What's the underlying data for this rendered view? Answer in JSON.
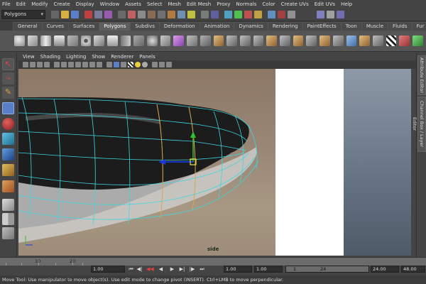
{
  "menubar": {
    "items": [
      "File",
      "Edit",
      "Modify",
      "Create",
      "Display",
      "Window",
      "Assets",
      "Select",
      "Mesh",
      "Edit Mesh",
      "Proxy",
      "Normals",
      "Color",
      "Create UVs",
      "Edit UVs",
      "Help"
    ]
  },
  "statusline": {
    "mode": "Polygons"
  },
  "shelf": {
    "tabs": [
      "General",
      "Curves",
      "Surfaces",
      "Polygons",
      "Subdivs",
      "Deformation",
      "Animation",
      "Dynamics",
      "Rendering",
      "PaintEffects",
      "Toon",
      "Muscle",
      "Fluids",
      "Fur"
    ],
    "active_tab": "Polygons"
  },
  "panel": {
    "menu": [
      "View",
      "Shading",
      "Lighting",
      "Show",
      "Renderer",
      "Panels"
    ],
    "view_label": "side"
  },
  "sidebar": {
    "tabs": [
      "Attribute Editor",
      "Channel Box / Layer Editor"
    ]
  },
  "timeslider": {
    "ticks": [
      "10",
      "20"
    ]
  },
  "range": {
    "current_start": "1.00",
    "anim_start": "1.00",
    "playback_start": "1.00",
    "range_min": "1",
    "range_max": "24",
    "playback_end": "24.00",
    "anim_end": "48.00"
  },
  "helpline": {
    "text": "Move Tool: Use manipulator to move object(s). Use edit mode to change pivot (INSERT).  Ctrl+LMB to move perpendicular."
  },
  "colors": {
    "wireframe": "#3fd6e0",
    "selected_edges": "#e8a040",
    "manip_x": "#1a3ae0",
    "manip_y": "#30c030",
    "manip_center": "#e8e030"
  }
}
